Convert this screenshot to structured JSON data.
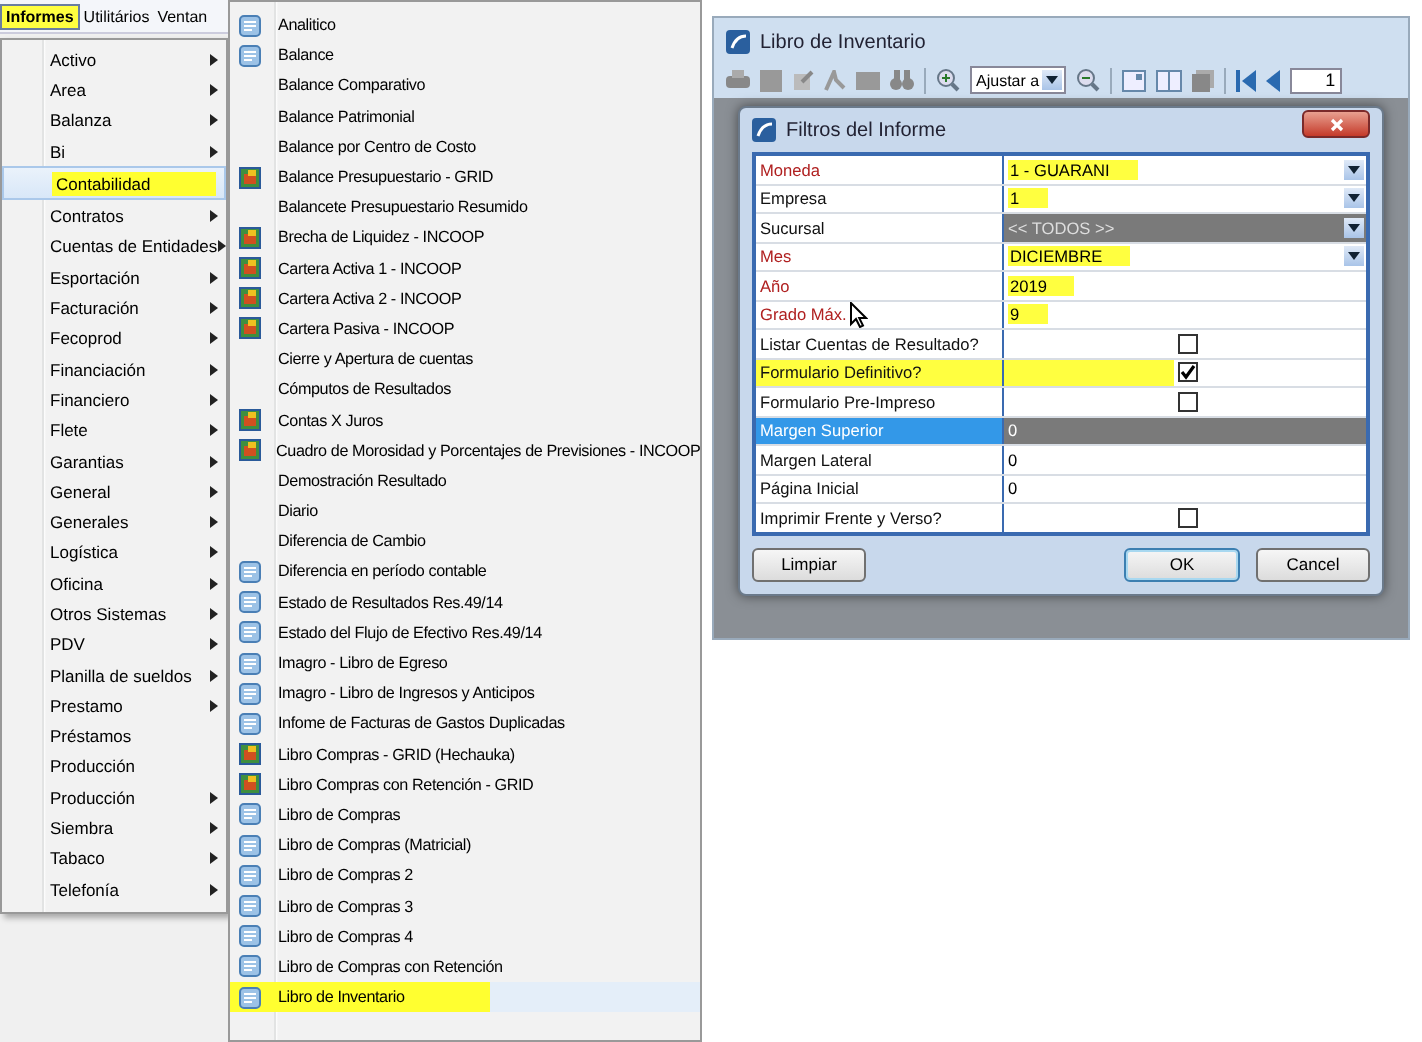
{
  "menubar": [
    {
      "label": "Informes",
      "selected": true
    },
    {
      "label": "Utilitários",
      "selected": false
    },
    {
      "label": "Ventan",
      "selected": false
    }
  ],
  "menu": {
    "items": [
      {
        "label": "Activo",
        "submenu": true,
        "selected": false
      },
      {
        "label": "Area",
        "submenu": true,
        "selected": false
      },
      {
        "label": "Balanza",
        "submenu": true,
        "selected": false
      },
      {
        "label": "Bi",
        "submenu": true,
        "selected": false
      },
      {
        "label": "Contabilidad",
        "submenu": false,
        "selected": true
      },
      {
        "label": "Contratos",
        "submenu": true,
        "selected": false
      },
      {
        "label": "Cuentas de Entidades",
        "submenu": true,
        "selected": false
      },
      {
        "label": "Esportación",
        "submenu": true,
        "selected": false
      },
      {
        "label": "Facturación",
        "submenu": true,
        "selected": false
      },
      {
        "label": "Fecoprod",
        "submenu": true,
        "selected": false
      },
      {
        "label": "Financiación",
        "submenu": true,
        "selected": false
      },
      {
        "label": "Financiero",
        "submenu": true,
        "selected": false
      },
      {
        "label": "Flete",
        "submenu": true,
        "selected": false
      },
      {
        "label": "Garantias",
        "submenu": true,
        "selected": false
      },
      {
        "label": "General",
        "submenu": true,
        "selected": false
      },
      {
        "label": "Generales",
        "submenu": true,
        "selected": false
      },
      {
        "label": "Logística",
        "submenu": true,
        "selected": false
      },
      {
        "label": "Oficina",
        "submenu": true,
        "selected": false
      },
      {
        "label": "Otros Sistemas",
        "submenu": true,
        "selected": false
      },
      {
        "label": "PDV",
        "submenu": true,
        "selected": false
      },
      {
        "label": "Planilla de sueldos",
        "submenu": true,
        "selected": false
      },
      {
        "label": "Prestamo",
        "submenu": true,
        "selected": false
      },
      {
        "label": "Préstamos",
        "submenu": false,
        "selected": false
      },
      {
        "label": "Producción",
        "submenu": false,
        "selected": false
      },
      {
        "label": "Producción",
        "submenu": true,
        "selected": false
      },
      {
        "label": "Siembra",
        "submenu": true,
        "selected": false
      },
      {
        "label": "Tabaco",
        "submenu": true,
        "selected": false
      },
      {
        "label": "Telefonía",
        "submenu": true,
        "selected": false
      }
    ]
  },
  "submenu": {
    "items": [
      {
        "label": "Analitico",
        "kind": "report",
        "selected": false
      },
      {
        "label": "Balance",
        "kind": "report",
        "selected": false
      },
      {
        "label": "Balance Comparativo",
        "kind": "plain",
        "selected": false
      },
      {
        "label": "Balance Patrimonial",
        "kind": "plain",
        "selected": false
      },
      {
        "label": "Balance por Centro de Costo",
        "kind": "plain",
        "selected": false
      },
      {
        "label": "Balance Presupuestario - GRID",
        "kind": "grid",
        "selected": false
      },
      {
        "label": "Balancete Presupuestario Resumido",
        "kind": "plain",
        "selected": false
      },
      {
        "label": "Brecha de Liquidez - INCOOP",
        "kind": "grid",
        "selected": false
      },
      {
        "label": "Cartera Activa 1 - INCOOP",
        "kind": "grid",
        "selected": false
      },
      {
        "label": "Cartera Activa 2 - INCOOP",
        "kind": "grid",
        "selected": false
      },
      {
        "label": "Cartera Pasiva - INCOOP",
        "kind": "grid",
        "selected": false
      },
      {
        "label": "Cierre y Apertura de cuentas",
        "kind": "plain",
        "selected": false
      },
      {
        "label": "Cómputos de Resultados",
        "kind": "plain",
        "selected": false
      },
      {
        "label": "Contas X Juros",
        "kind": "grid",
        "selected": false
      },
      {
        "label": "Cuadro de Morosidad y Porcentajes de Previsiones - INCOOP",
        "kind": "grid",
        "selected": false
      },
      {
        "label": "Demostración Resultado",
        "kind": "plain",
        "selected": false
      },
      {
        "label": "Diario",
        "kind": "plain",
        "selected": false
      },
      {
        "label": "Diferencia de Cambio",
        "kind": "plain",
        "selected": false
      },
      {
        "label": "Diferencia en período contable",
        "kind": "report",
        "selected": false
      },
      {
        "label": "Estado de Resultados Res.49/14",
        "kind": "report",
        "selected": false
      },
      {
        "label": "Estado del Flujo de Efectivo Res.49/14",
        "kind": "report",
        "selected": false
      },
      {
        "label": "Imagro - Libro de Egreso",
        "kind": "report",
        "selected": false
      },
      {
        "label": "Imagro - Libro de Ingresos y Anticipos",
        "kind": "report",
        "selected": false
      },
      {
        "label": "Infome de Facturas de Gastos Duplicadas",
        "kind": "report",
        "selected": false
      },
      {
        "label": "Libro Compras - GRID (Hechauka)",
        "kind": "grid",
        "selected": false
      },
      {
        "label": "Libro Compras con Retención - GRID",
        "kind": "grid",
        "selected": false
      },
      {
        "label": "Libro de Compras",
        "kind": "report",
        "selected": false
      },
      {
        "label": "Libro de Compras (Matricial)",
        "kind": "report",
        "selected": false
      },
      {
        "label": "Libro de Compras 2",
        "kind": "report",
        "selected": false
      },
      {
        "label": "Libro de Compras 3",
        "kind": "report",
        "selected": false
      },
      {
        "label": "Libro de Compras 4",
        "kind": "report",
        "selected": false
      },
      {
        "label": "Libro de Compras con Retención",
        "kind": "report",
        "selected": false
      },
      {
        "label": "Libro de Inventario",
        "kind": "report",
        "selected": true
      }
    ]
  },
  "report_window": {
    "title": "Libro de Inventario",
    "zoom": "Ajustar a",
    "page": "1",
    "dialog": {
      "title": "Filtros del Informe",
      "rows": [
        {
          "label": "Moneda",
          "kind": "select",
          "value": "1 - GUARANI",
          "required": true,
          "disabled": false,
          "selected": false,
          "highlighted": true
        },
        {
          "label": "Empresa",
          "kind": "select",
          "value": "1",
          "required": false,
          "disabled": false,
          "selected": false,
          "highlighted": true
        },
        {
          "label": "Sucursal",
          "kind": "select",
          "value": "<< TODOS >>",
          "required": false,
          "disabled": true,
          "selected": false,
          "highlighted": false
        },
        {
          "label": "Mes",
          "kind": "select",
          "value": "DICIEMBRE",
          "required": true,
          "disabled": false,
          "selected": false,
          "highlighted": true
        },
        {
          "label": "Año",
          "kind": "text",
          "value": "2019",
          "required": true,
          "disabled": false,
          "selected": false,
          "highlighted": true
        },
        {
          "label": "Grado Máx.",
          "kind": "text",
          "value": "9",
          "required": true,
          "disabled": false,
          "selected": false,
          "highlighted": true
        },
        {
          "label": "Listar Cuentas de Resultado?",
          "kind": "checkbox",
          "checked": false,
          "required": false,
          "disabled": false,
          "selected": false,
          "highlighted": false
        },
        {
          "label": "Formulario Definitivo?",
          "kind": "checkbox",
          "checked": true,
          "required": false,
          "disabled": false,
          "selected": false,
          "highlighted": true
        },
        {
          "label": "Formulario Pre-Impreso",
          "kind": "checkbox",
          "checked": false,
          "required": false,
          "disabled": false,
          "selected": false,
          "highlighted": false
        },
        {
          "label": "Margen Superior",
          "kind": "text",
          "value": "0",
          "required": false,
          "disabled": false,
          "selected": true,
          "highlighted": false
        },
        {
          "label": "Margen Lateral",
          "kind": "text",
          "value": "0",
          "required": false,
          "disabled": false,
          "selected": false,
          "highlighted": false
        },
        {
          "label": "Página Inicial",
          "kind": "text",
          "value": "0",
          "required": false,
          "disabled": false,
          "selected": false,
          "highlighted": false
        },
        {
          "label": "Imprimir Frente y Verso?",
          "kind": "checkbox",
          "checked": false,
          "required": false,
          "disabled": false,
          "selected": false,
          "highlighted": false
        }
      ],
      "buttons": [
        {
          "label": "Limpiar",
          "default": false
        },
        {
          "label": "OK",
          "default": true
        },
        {
          "label": "Cancel",
          "default": false
        }
      ]
    }
  }
}
